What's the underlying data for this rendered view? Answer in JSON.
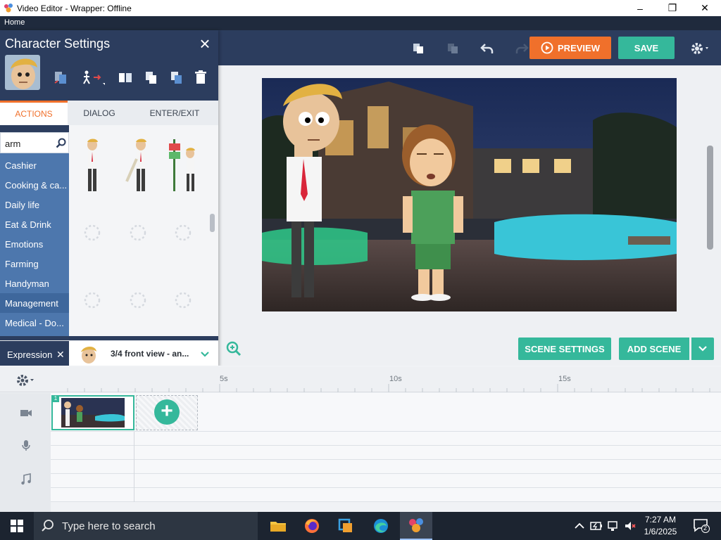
{
  "window": {
    "title": "Video Editor - Wrapper: Offline",
    "controls": [
      "–",
      "❐",
      "✕"
    ]
  },
  "menu": {
    "home": "Home"
  },
  "toolbar": {
    "preview_label": "PREVIEW",
    "save_label": "SAVE"
  },
  "panel": {
    "title": "Character Settings",
    "tabs": [
      {
        "label": "ACTIONS",
        "active": true
      },
      {
        "label": "DIALOG",
        "active": false
      },
      {
        "label": "ENTER/EXIT",
        "active": false
      }
    ],
    "search_value": "arm",
    "categories": [
      {
        "label": "Cashier"
      },
      {
        "label": "Cooking & ca..."
      },
      {
        "label": "Daily life"
      },
      {
        "label": "Eat & Drink"
      },
      {
        "label": "Emotions"
      },
      {
        "label": "Farming"
      },
      {
        "label": "Handyman"
      },
      {
        "label": "Management",
        "selected": true
      },
      {
        "label": "Medical - Do..."
      }
    ],
    "expression": {
      "tag": "Expression",
      "value": "3/4 front view - an..."
    }
  },
  "stage": {
    "scene_settings_label": "SCENE SETTINGS",
    "add_scene_label": "ADD SCENE"
  },
  "timeline": {
    "ticks": [
      "5s",
      "10s",
      "15s"
    ],
    "scene_number": "1"
  },
  "taskbar": {
    "search_placeholder": "Type here to search",
    "time": "7:27 AM",
    "date": "1/6/2025",
    "notification_count": "2"
  },
  "colors": {
    "accent_orange": "#f0702b",
    "accent_teal": "#35b89b",
    "header_navy": "#2c3d5e",
    "category_blue": "#4d77ad"
  }
}
